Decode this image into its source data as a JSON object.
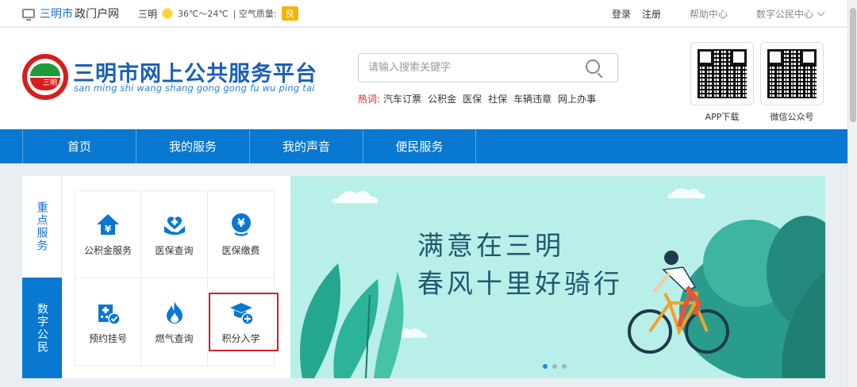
{
  "topbar": {
    "city": "三明市",
    "site": "政门户网",
    "weather_city": "三明",
    "temperature": "36℃～24℃",
    "air_quality_label": "| 空气质量:",
    "air_quality_value": "良",
    "login": "登录",
    "register": "注册",
    "help": "帮助中心",
    "digital_citizen": "数字公民中心"
  },
  "header": {
    "logo_text": "三明",
    "title": "三明市网上公共服务平台",
    "pinyin": "san ming shi wang shang gong gong fu wu ping tai",
    "search_placeholder": "请输入搜索关键字",
    "hot_label": "热词:",
    "hot_words": [
      "汽车订票",
      "公积金",
      "医保",
      "社保",
      "车辆违章",
      "网上办事"
    ],
    "qr_app": "APP下载",
    "qr_wechat": "微信公众号"
  },
  "nav": {
    "items": [
      "首页",
      "我的服务",
      "我的声音",
      "便民服务"
    ]
  },
  "panel": {
    "tab_key": "重点服务",
    "tab_digital": "数字公民",
    "services": [
      {
        "label": "公积金服务",
        "icon": "housing-fund-icon"
      },
      {
        "label": "医保查询",
        "icon": "medical-insurance-icon"
      },
      {
        "label": "医保缴费",
        "icon": "payment-icon"
      },
      {
        "label": "预约挂号",
        "icon": "hospital-icon"
      },
      {
        "label": "燃气查询",
        "icon": "flame-icon"
      },
      {
        "label": "积分入学",
        "icon": "graduation-cap-icon"
      }
    ]
  },
  "banner": {
    "line1": "满意在三明",
    "line2": "春风十里好骑行"
  },
  "colors": {
    "primary": "#0878d1",
    "accent_red": "#d71d1d",
    "banner_bg": "#b9efe9"
  }
}
